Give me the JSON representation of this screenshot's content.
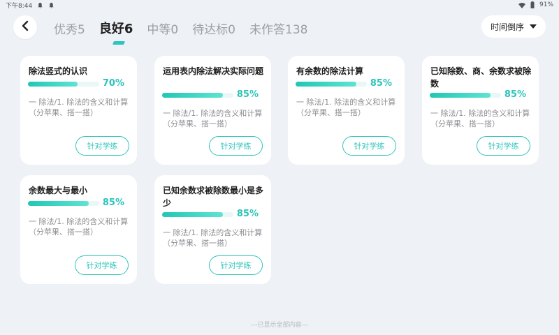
{
  "status_bar": {
    "time": "下午8:44",
    "battery": "91%",
    "left_icons": [
      "bell-icon",
      "bell-icon"
    ],
    "right_icons": [
      "wifi-icon",
      "battery-icon"
    ]
  },
  "header": {
    "back_icon": "chevron-left-icon",
    "tabs": [
      {
        "label": "优秀5",
        "active": false
      },
      {
        "label": "良好6",
        "active": true
      },
      {
        "label": "中等0",
        "active": false
      },
      {
        "label": "待达标0",
        "active": false
      },
      {
        "label": "未作答138",
        "active": false
      }
    ],
    "sort": {
      "label": "时间倒序",
      "icon": "caret-down-icon"
    }
  },
  "accent_color": "#2ec4bb",
  "cards": [
    {
      "title": "除法竖式的认识",
      "progress": 70,
      "percent_label": "70%",
      "desc": "一 除法/1. 除法的含义和计算（分苹果、搭一搭）",
      "button": "针对学练"
    },
    {
      "title": "运用表内除法解决实际问题",
      "progress": 85,
      "percent_label": "85%",
      "desc": "一 除法/1. 除法的含义和计算（分苹果、搭一搭）",
      "button": "针对学练"
    },
    {
      "title": "有余数的除法计算",
      "progress": 85,
      "percent_label": "85%",
      "desc": "一 除法/1. 除法的含义和计算（分苹果、搭一搭）",
      "button": "针对学练"
    },
    {
      "title": "已知除数、商、余数求被除数",
      "progress": 85,
      "percent_label": "85%",
      "desc": "一 除法/1. 除法的含义和计算（分苹果、搭一搭）",
      "button": "针对学练"
    },
    {
      "title": "余数最大与最小",
      "progress": 85,
      "percent_label": "85%",
      "desc": "一 除法/1. 除法的含义和计算（分苹果、搭一搭）",
      "button": "针对学练"
    },
    {
      "title": "已知余数求被除数最小是多少",
      "progress": 85,
      "percent_label": "85%",
      "desc": "一 除法/1. 除法的含义和计算（分苹果、搭一搭）",
      "button": "针对学练"
    }
  ],
  "footer_note": "---已显示全部内容---"
}
